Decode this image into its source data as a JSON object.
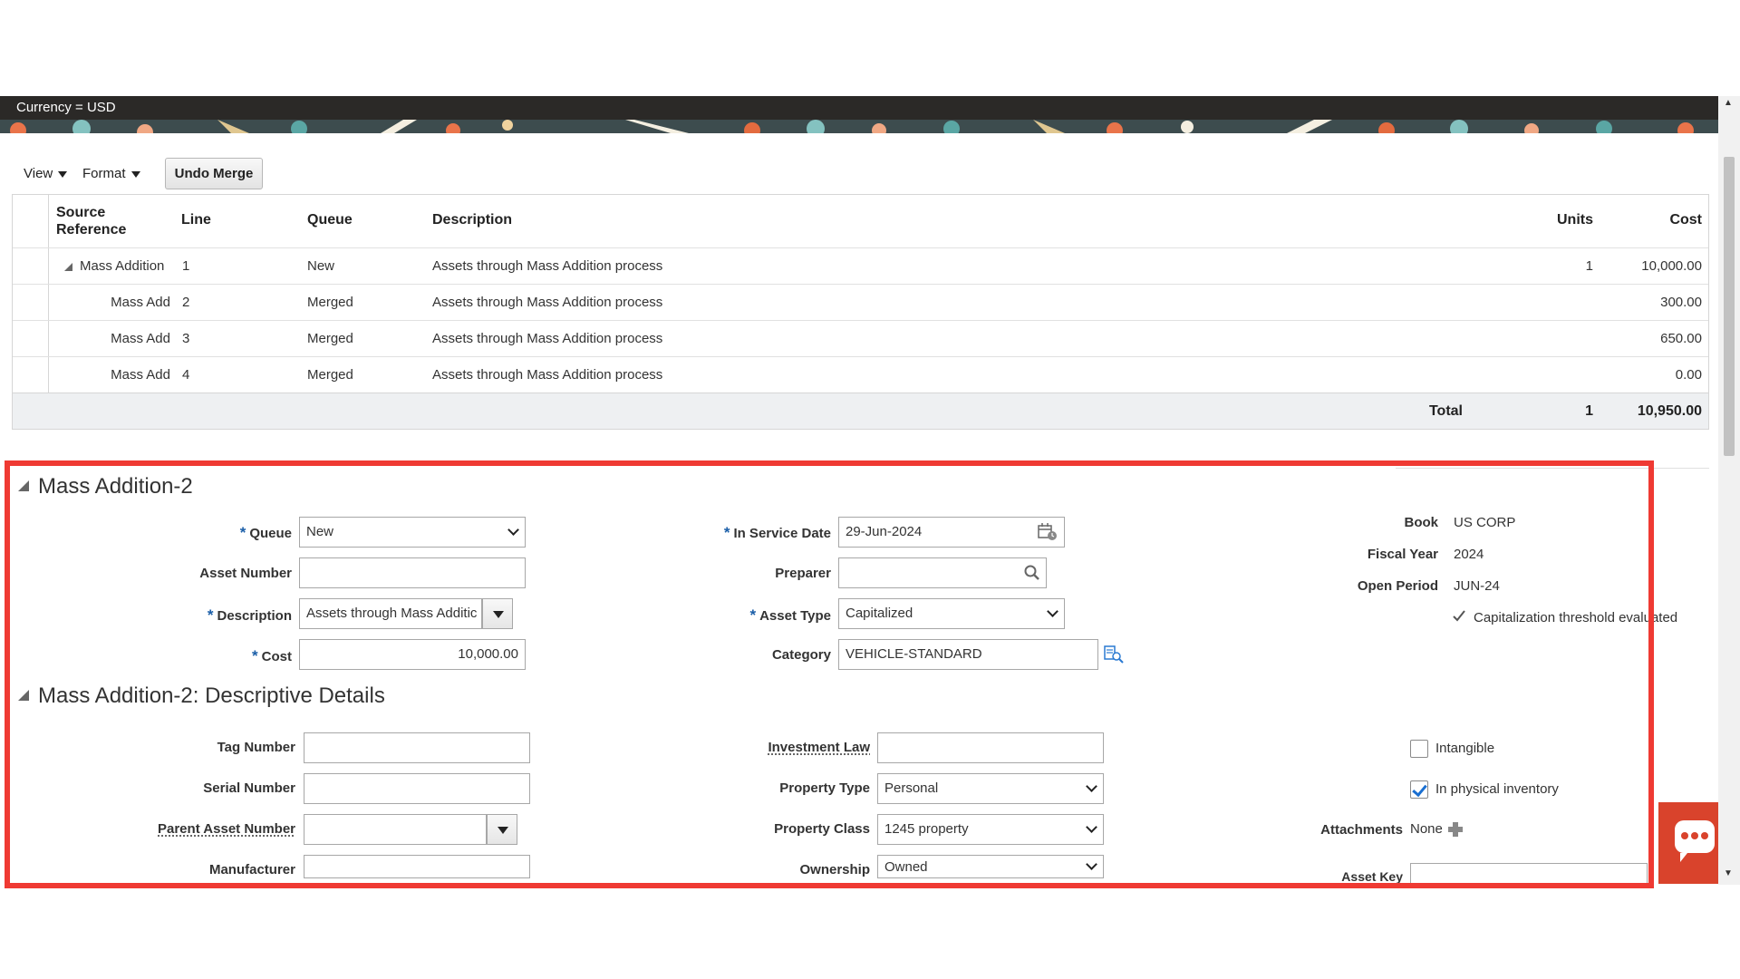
{
  "header": {
    "currency_label": "Currency = USD"
  },
  "toolbar": {
    "view_label": "View",
    "format_label": "Format",
    "undo_merge_label": "Undo Merge"
  },
  "table": {
    "headers": {
      "source_reference": [
        "Source",
        "Reference"
      ],
      "line": "Line",
      "queue": "Queue",
      "description": "Description",
      "units": "Units",
      "cost": "Cost"
    },
    "rows": [
      {
        "source": "Mass Addition",
        "line": "1",
        "queue": "New",
        "description": "Assets through Mass Addition process",
        "units": "1",
        "cost": "10,000.00"
      },
      {
        "source": "Mass Add",
        "line": "2",
        "queue": "Merged",
        "description": "Assets through Mass Addition process",
        "units": "",
        "cost": "300.00"
      },
      {
        "source": "Mass Add",
        "line": "3",
        "queue": "Merged",
        "description": "Assets through Mass Addition process",
        "units": "",
        "cost": "650.00"
      },
      {
        "source": "Mass Add",
        "line": "4",
        "queue": "Merged",
        "description": "Assets through Mass Addition process",
        "units": "",
        "cost": "0.00"
      }
    ],
    "total": {
      "label": "Total",
      "units": "1",
      "cost": "10,950.00"
    }
  },
  "section1": {
    "title": "Mass Addition-2",
    "queue_label": "Queue",
    "queue_value": "New",
    "asset_number_label": "Asset Number",
    "asset_number_value": "",
    "description_label": "Description",
    "description_value": "Assets through Mass Additic",
    "cost_label": "Cost",
    "cost_value": "10,000.00",
    "in_service_date_label": "In Service Date",
    "in_service_date_value": "29-Jun-2024",
    "preparer_label": "Preparer",
    "preparer_value": "",
    "asset_type_label": "Asset Type",
    "asset_type_value": "Capitalized",
    "category_label": "Category",
    "category_value": "VEHICLE-STANDARD",
    "book_label": "Book",
    "book_value": "US CORP",
    "fiscal_year_label": "Fiscal Year",
    "fiscal_year_value": "2024",
    "open_period_label": "Open Period",
    "open_period_value": "JUN-24",
    "threshold_text": "Capitalization threshold evaluated"
  },
  "section2": {
    "title": "Mass Addition-2: Descriptive Details",
    "tag_number_label": "Tag Number",
    "tag_number_value": "",
    "serial_number_label": "Serial Number",
    "serial_number_value": "",
    "parent_asset_label": "Parent Asset Number",
    "parent_asset_value": "",
    "manufacturer_label": "Manufacturer",
    "manufacturer_value": "",
    "investment_law_label": "Investment Law",
    "investment_law_value": "",
    "property_type_label": "Property Type",
    "property_type_value": "Personal",
    "property_class_label": "Property Class",
    "property_class_value": "1245 property",
    "ownership_label": "Ownership",
    "ownership_value": "Owned",
    "intangible_label": "Intangible",
    "intangible_checked": false,
    "physical_inventory_label": "In physical inventory",
    "physical_inventory_checked": true,
    "attachments_label": "Attachments",
    "attachments_value": "None",
    "asset_key_label": "Asset Key"
  },
  "icons": [
    "calendar-icon",
    "search-icon",
    "category-lookup-icon",
    "add-attachment-icon",
    "chat-icon",
    "check-icon"
  ],
  "colors": {
    "highlight": "#ef3a33",
    "header_bg": "#2b2927",
    "required_star": "#1a5ea8",
    "checkbox_check": "#1a6fd1",
    "chat_bg": "#d9432c"
  }
}
